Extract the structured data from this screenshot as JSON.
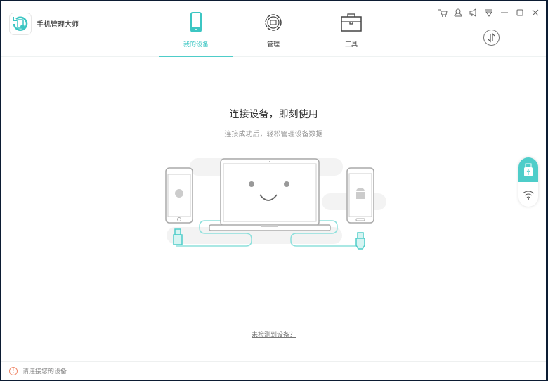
{
  "app": {
    "name": "手机管理大师"
  },
  "tabs": [
    {
      "label": "我的设备",
      "icon": "phone-icon",
      "active": true
    },
    {
      "label": "管理",
      "icon": "gear-icon"
    },
    {
      "label": "工具",
      "icon": "toolbox-icon"
    }
  ],
  "main": {
    "title": "连接设备，即刻使用",
    "subtitle": "连接成功后，轻松管理设备数据",
    "help_link": "未检测到设备？"
  },
  "status": {
    "text": "请连接您的设备"
  },
  "colors": {
    "accent": "#4ecdc9",
    "warning": "#f08a6c"
  }
}
